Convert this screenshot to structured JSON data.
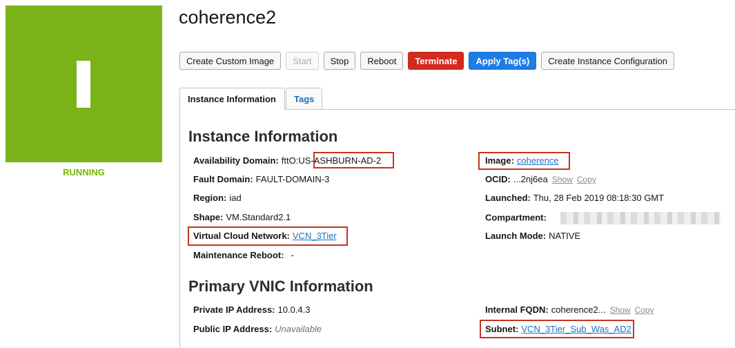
{
  "instance": {
    "name": "coherence2",
    "status": "RUNNING",
    "tile_color": "#7ab317",
    "status_color": "#76b900"
  },
  "actions": [
    {
      "label": "Create Custom Image",
      "state": "normal"
    },
    {
      "label": "Start",
      "state": "disabled"
    },
    {
      "label": "Stop",
      "state": "normal"
    },
    {
      "label": "Reboot",
      "state": "normal"
    },
    {
      "label": "Terminate",
      "state": "danger"
    },
    {
      "label": "Apply Tag(s)",
      "state": "primary"
    },
    {
      "label": "Create Instance Configuration",
      "state": "normal"
    }
  ],
  "tabs": [
    {
      "label": "Instance Information",
      "active": true
    },
    {
      "label": "Tags",
      "active": false
    }
  ],
  "instance_info": {
    "heading": "Instance Information",
    "availability_domain": {
      "label": "Availability Domain:",
      "value": "fttO:US-ASHBURN-AD-2"
    },
    "fault_domain": {
      "label": "Fault Domain:",
      "value": "FAULT-DOMAIN-3"
    },
    "region": {
      "label": "Region:",
      "value": "iad"
    },
    "shape": {
      "label": "Shape:",
      "value": "VM.Standard2.1"
    },
    "vcn": {
      "label": "Virtual Cloud Network:",
      "value": "VCN_3Tier"
    },
    "maintenance": {
      "label": "Maintenance Reboot:",
      "value": "-"
    },
    "image": {
      "label": "Image:",
      "value": "coherence"
    },
    "ocid": {
      "label": "OCID:",
      "value": "...2nj6ea",
      "show": "Show",
      "copy": "Copy"
    },
    "launched": {
      "label": "Launched:",
      "value": "Thu, 28 Feb 2019 08:18:30 GMT"
    },
    "compartment": {
      "label": "Compartment:"
    },
    "launch_mode": {
      "label": "Launch Mode:",
      "value": "NATIVE"
    }
  },
  "vnic_info": {
    "heading": "Primary VNIC Information",
    "private_ip": {
      "label": "Private IP Address:",
      "value": "10.0.4.3"
    },
    "public_ip": {
      "label": "Public IP Address:",
      "value": "Unavailable"
    },
    "fqdn": {
      "label": "Internal FQDN:",
      "value": "coherence2...",
      "show": "Show",
      "copy": "Copy"
    },
    "subnet": {
      "label": "Subnet:",
      "value": "VCN_3Tier_Sub_Was_AD2"
    }
  },
  "highlight_color": "#c7331f"
}
